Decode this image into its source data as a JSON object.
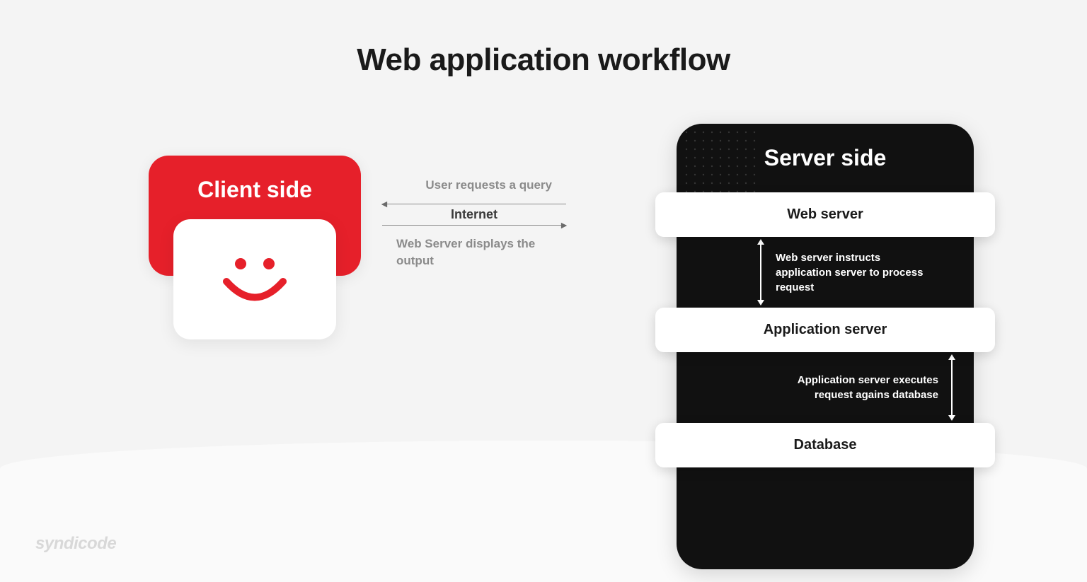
{
  "title": "Web application workflow",
  "client": {
    "label": "Client side"
  },
  "middle": {
    "request_label": "User requests a query",
    "internet_label": "Internet",
    "response_label": "Web Server displays the output"
  },
  "server": {
    "label": "Server side",
    "layers": {
      "web_server": "Web server",
      "app_server": "Application server",
      "database": "Database"
    },
    "transitions": {
      "web_to_app": "Web server instructs application server to process request",
      "app_to_db": "Application server executes request agains database"
    }
  },
  "watermark": "syndicode"
}
